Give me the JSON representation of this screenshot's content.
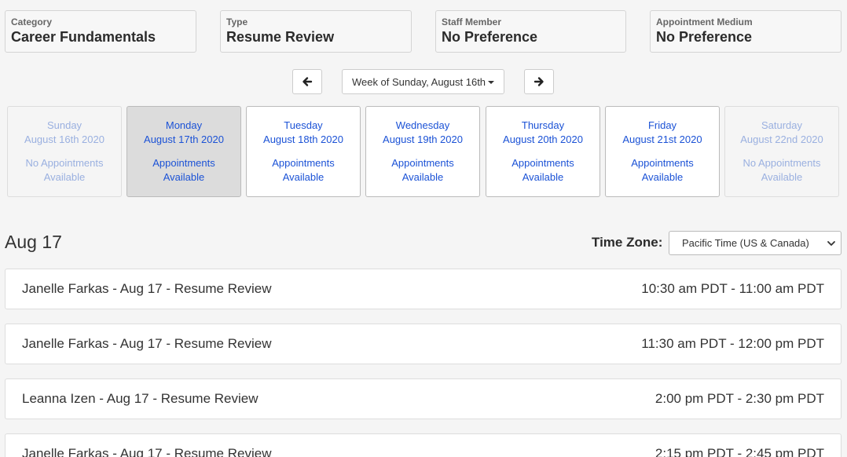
{
  "filters": [
    {
      "label": "Category",
      "value": "Career Fundamentals"
    },
    {
      "label": "Type",
      "value": "Resume Review"
    },
    {
      "label": "Staff Member",
      "value": "No Preference"
    },
    {
      "label": "Appointment Medium",
      "value": "No Preference"
    }
  ],
  "week": {
    "label": "Week of Sunday, August 16th",
    "prev_icon": "arrow-left-icon",
    "next_icon": "arrow-right-icon"
  },
  "days": [
    {
      "name": "Sunday",
      "date": "August 16th 2020",
      "status_1": "No Appointments",
      "status_2": "Available",
      "state": "disabled"
    },
    {
      "name": "Monday",
      "date": "August 17th 2020",
      "status_1": "Appointments",
      "status_2": "Available",
      "state": "selected"
    },
    {
      "name": "Tuesday",
      "date": "August 18th 2020",
      "status_1": "Appointments",
      "status_2": "Available",
      "state": "available"
    },
    {
      "name": "Wednesday",
      "date": "August 19th 2020",
      "status_1": "Appointments",
      "status_2": "Available",
      "state": "available"
    },
    {
      "name": "Thursday",
      "date": "August 20th 2020",
      "status_1": "Appointments",
      "status_2": "Available",
      "state": "available"
    },
    {
      "name": "Friday",
      "date": "August 21st 2020",
      "status_1": "Appointments",
      "status_2": "Available",
      "state": "available"
    },
    {
      "name": "Saturday",
      "date": "August 22nd 2020",
      "status_1": "No Appointments",
      "status_2": "Available",
      "state": "disabled"
    }
  ],
  "selected_date": "Aug 17",
  "timezone": {
    "label": "Time Zone:",
    "value": "Pacific Time (US & Canada)"
  },
  "slots": [
    {
      "title": "Janelle Farkas - Aug 17 - Resume Review",
      "time": "10:30 am PDT - 11:00 am PDT"
    },
    {
      "title": "Janelle Farkas - Aug 17 - Resume Review",
      "time": "11:30 am PDT - 12:00 pm PDT"
    },
    {
      "title": "Leanna Izen - Aug 17 - Resume Review",
      "time": "2:00 pm PDT - 2:30 pm PDT"
    },
    {
      "title": "Janelle Farkas - Aug 17 - Resume Review",
      "time": "2:15 pm PDT - 2:45 pm PDT"
    }
  ],
  "colors": {
    "link_blue": "#1b52d6",
    "selected_bg": "#dcdcdc"
  }
}
